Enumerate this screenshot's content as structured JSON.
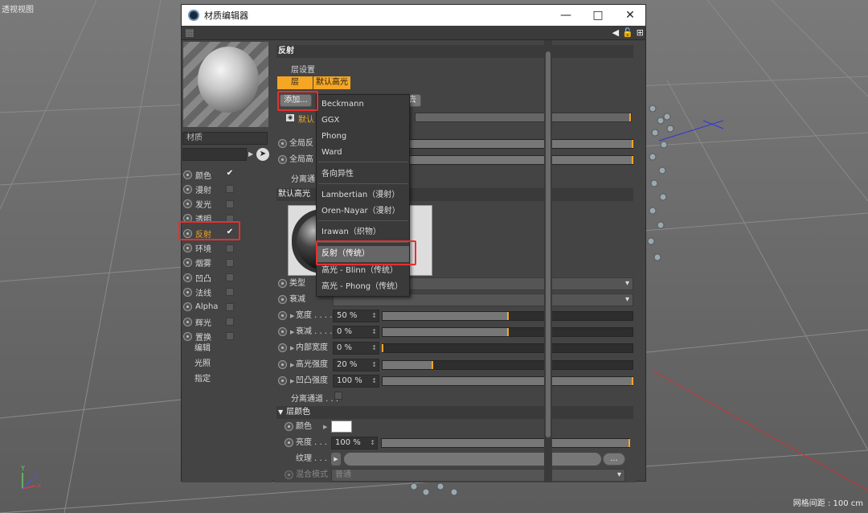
{
  "viewport": {
    "label": "透视视图",
    "grid_spacing": "网格间距 : 100 cm",
    "axis_x": "X",
    "axis_y": "Y",
    "axis_z": "Z"
  },
  "window": {
    "title": "材质编辑器"
  },
  "left": {
    "material_name": "材质",
    "channels": [
      {
        "label": "颜色",
        "checked": true
      },
      {
        "label": "漫射",
        "checked": false
      },
      {
        "label": "发光",
        "checked": false
      },
      {
        "label": "透明",
        "checked": false
      },
      {
        "label": "反射",
        "checked": true
      },
      {
        "label": "环境",
        "checked": false
      },
      {
        "label": "烟雾",
        "checked": false
      },
      {
        "label": "凹凸",
        "checked": false
      },
      {
        "label": "法线",
        "checked": false
      },
      {
        "label": "Alpha",
        "checked": false
      },
      {
        "label": "辉光",
        "checked": false
      },
      {
        "label": "置换",
        "checked": false
      }
    ],
    "extra": [
      "编辑",
      "光照",
      "指定"
    ]
  },
  "reflect": {
    "header": "反射",
    "layer_settings": "层设置",
    "tab_layer": "层",
    "tab_default": "默认高光",
    "add_button": "添加...",
    "remove_button": "去",
    "default_layer": "默认",
    "global_reflect": "全局反",
    "global_spec": "全局高",
    "separate_pass": "分离通"
  },
  "spec": {
    "header": "默认高光",
    "type_label": "类型",
    "atten_label": "衰减",
    "rows": [
      {
        "label": "宽度 . . . .",
        "value": "50 %",
        "fraction": 0.5
      },
      {
        "label": "衰减 . . . .",
        "value": "0 %",
        "fraction": 0.5
      },
      {
        "label": "内部宽度",
        "value": "0 %",
        "fraction": 0.0
      },
      {
        "label": "高光强度",
        "value": "20 %",
        "fraction": 0.2
      },
      {
        "label": "凹凸强度",
        "value": "100 %",
        "fraction": 1.0
      }
    ],
    "separate": "分离通道 . . ."
  },
  "layer_color": {
    "header": "层颜色",
    "color_label": "颜色",
    "brightness_label": "亮度 . . .",
    "brightness_value": "100 %",
    "brightness_fraction": 1.0,
    "texture_label": "纹理 . . .",
    "texture_btn": "...",
    "blend_label": "混合模式",
    "blend_value": "普通"
  },
  "menu": {
    "items": [
      "Beckmann",
      "GGX",
      "Phong",
      "Ward",
      "各向异性",
      "Lambertian（漫射）",
      "Oren-Nayar（漫射）",
      "Irawan（织物）",
      "反射（传统）",
      "高光 - Blinn（传统）",
      "高光 - Phong（传统）"
    ],
    "highlighted": "反射（传统）"
  },
  "colors": {
    "accent": "#f5a623",
    "highlight_box": "#e53030"
  }
}
